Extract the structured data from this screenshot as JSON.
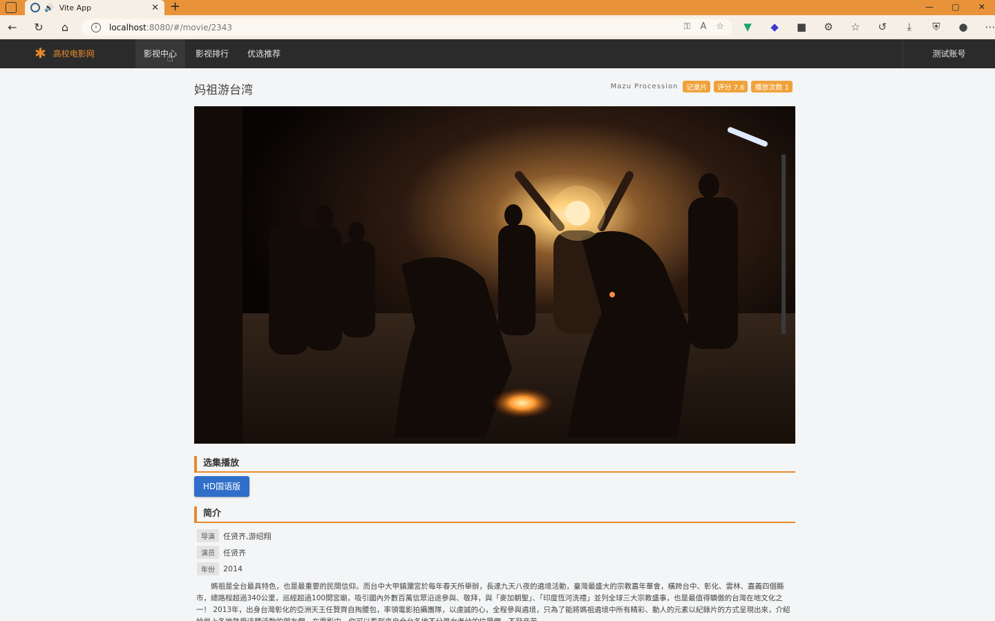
{
  "browser": {
    "tab_title": "Vite App",
    "url_host": "localhost",
    "url_path": ":8080/#/movie/2343"
  },
  "nav": {
    "brand": "高校电影网",
    "items": [
      {
        "label": "影视中心"
      },
      {
        "label": "影视排行"
      },
      {
        "label": "优选推荐"
      }
    ],
    "account": "测试账号"
  },
  "movie": {
    "title": "妈祖游台湾",
    "english_title": "Mazu Procession",
    "tags": [
      "记录片",
      "评分 7.6",
      "播放次数 1"
    ]
  },
  "episodes": {
    "heading": "选集播放",
    "items": [
      "HD国语版"
    ]
  },
  "intro": {
    "heading": "简介",
    "director_label": "导演",
    "director": "任贤齐,游绍翔",
    "cast_label": "演员",
    "cast": "任贤齐",
    "year_label": "年份",
    "year": "2014",
    "description": "媽祖是全台最具特色，也是最重要的民間信仰。而台中大甲鎮瀾宮於每年春天所舉辦，長達九天八夜的遶境活動，臺灣最盛大的宗教嘉年華會，橫跨台中、彰化、雲林、嘉義四個縣市，總路程超過340公里，巡經超過100間宮廟，吸引國內外數百萬信眾沿途參與、敬拜，與「麥加朝聖」、「印度恆河洗禮」並列全球三大宗教盛事，也是最值得驕傲的台灣在地文化之一！ 2013年，出身台灣彰化的亞洲天王任賢齊自掏腰包，率領電影拍攝團隊，以虔誠的心，全程參與遶境，只為了能將媽祖遶境中所有精彩、動人的元素以紀錄片的方式呈現出來，介紹給世上各地熱愛這種活動的朋友們。在電影中，你可以看到來自全台各地不分男女老幼的信眾們，不辭辛苦......"
  }
}
